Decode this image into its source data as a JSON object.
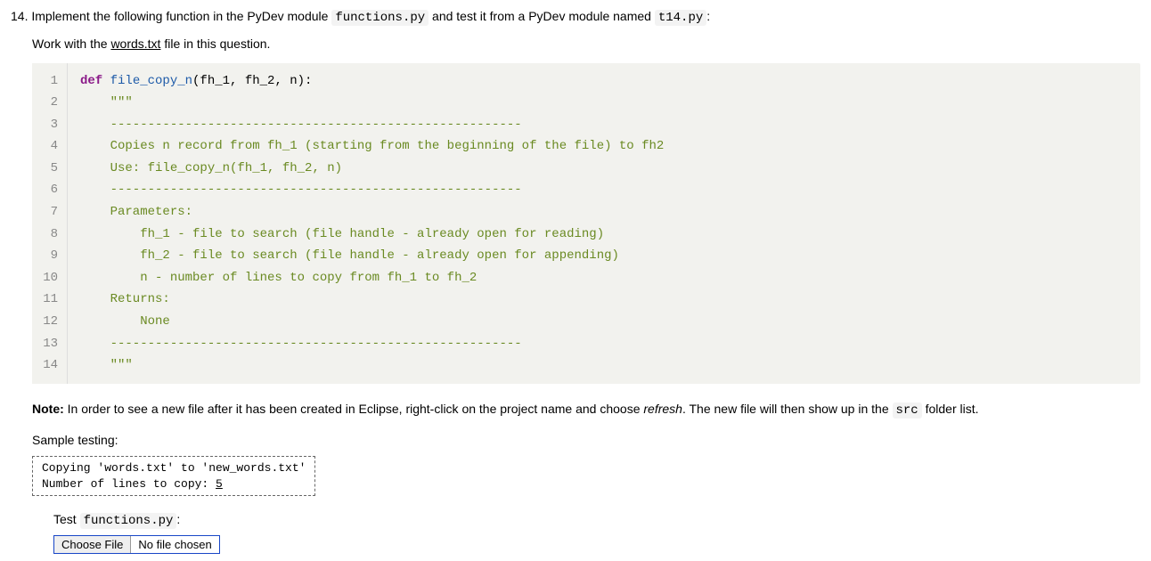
{
  "question": {
    "number": "14.",
    "intro_before": " Implement the following function in the PyDev module ",
    "module_code": "functions.py",
    "intro_middle": " and test it from a PyDev module named ",
    "test_module_code": "t14.py",
    "intro_after": ":"
  },
  "work_with_before": "Work with the ",
  "work_with_link": "words.txt",
  "work_with_after": " file in this question.",
  "code": {
    "lines": [
      {
        "n": "1",
        "segments": [
          {
            "t": "def ",
            "c": "kw"
          },
          {
            "t": "file_copy_n",
            "c": "fn"
          },
          {
            "t": "(fh_1, fh_2, n):",
            "c": ""
          }
        ]
      },
      {
        "n": "2",
        "segments": [
          {
            "t": "    \"\"\"",
            "c": "docstr"
          }
        ]
      },
      {
        "n": "3",
        "segments": [
          {
            "t": "    -------------------------------------------------------",
            "c": "docstr"
          }
        ]
      },
      {
        "n": "4",
        "segments": [
          {
            "t": "    Copies n record from fh_1 (starting from the beginning of the file) to fh2",
            "c": "docstr"
          }
        ]
      },
      {
        "n": "5",
        "segments": [
          {
            "t": "    Use: file_copy_n(fh_1, fh_2, n)",
            "c": "docstr"
          }
        ]
      },
      {
        "n": "6",
        "segments": [
          {
            "t": "    -------------------------------------------------------",
            "c": "docstr"
          }
        ]
      },
      {
        "n": "7",
        "segments": [
          {
            "t": "    Parameters:",
            "c": "docstr"
          }
        ]
      },
      {
        "n": "8",
        "segments": [
          {
            "t": "        fh_1 - file to search (file handle - already open for reading)",
            "c": "docstr"
          }
        ]
      },
      {
        "n": "9",
        "segments": [
          {
            "t": "        fh_2 - file to search (file handle - already open for appending)",
            "c": "docstr"
          }
        ]
      },
      {
        "n": "10",
        "segments": [
          {
            "t": "        n - number of lines to copy from fh_1 to fh_2",
            "c": "docstr"
          }
        ]
      },
      {
        "n": "11",
        "segments": [
          {
            "t": "    Returns:",
            "c": "docstr"
          }
        ]
      },
      {
        "n": "12",
        "segments": [
          {
            "t": "        None",
            "c": "docstr"
          }
        ]
      },
      {
        "n": "13",
        "segments": [
          {
            "t": "    -------------------------------------------------------",
            "c": "docstr"
          }
        ]
      },
      {
        "n": "14",
        "segments": [
          {
            "t": "    \"\"\"",
            "c": "docstr"
          }
        ]
      }
    ]
  },
  "note": {
    "label": "Note:",
    "before_italic": " In order to see a new file after it has been created in Eclipse, right-click on the project name and choose ",
    "italic_word": "refresh",
    "after_italic": ". The new file will then show up in the ",
    "src_code": "src",
    "after_src": " folder list."
  },
  "sample_label": "Sample testing:",
  "sample_output": {
    "line1": "Copying 'words.txt' to 'new_words.txt'",
    "line2_prefix": "Number of lines to copy: ",
    "line2_input": "5"
  },
  "test_section": {
    "before_code": "Test ",
    "code": "functions.py",
    "after_code": ":"
  },
  "file_chooser": {
    "button_label": "Choose File",
    "status_text": "No file chosen"
  }
}
